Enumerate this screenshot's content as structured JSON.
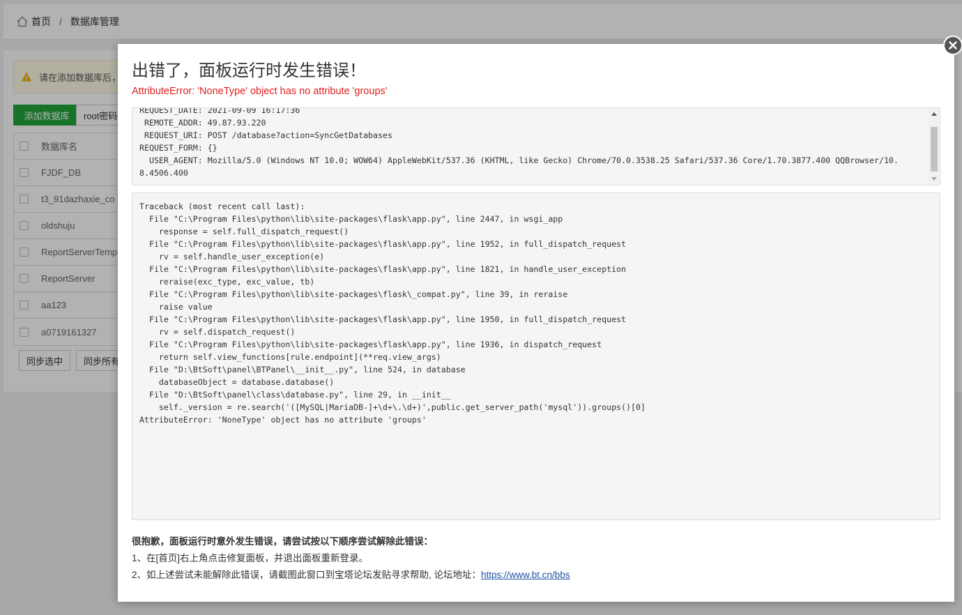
{
  "breadcrumb": {
    "home": "首页",
    "sep": "/",
    "current": "数据库管理"
  },
  "notice": {
    "text": "请在添加数据库后，务"
  },
  "toolbar": {
    "add_label": "添加数据库",
    "root_label": "root密码"
  },
  "table": {
    "header": "数据库名",
    "rows": [
      "FJDF_DB",
      "t3_91dazhaxie_co",
      "oldshuju",
      "ReportServerTempD",
      "ReportServer",
      "aa123",
      "a0719161327"
    ]
  },
  "bottom_buttons": {
    "sync_selected": "同步选中",
    "sync_all": "同步所有"
  },
  "modal": {
    "title": "出错了，面板运行时发生错误！",
    "error": "AttributeError: 'NoneType' object has no attribute 'groups'",
    "request_info": "REQUEST_DATE: 2021-09-09 16:17:36\n REMOTE_ADDR: 49.87.93.220\n REQUEST_URI: POST /database?action=SyncGetDatabases\nREQUEST_FORM: {}\n  USER_AGENT: Mozilla/5.0 (Windows NT 10.0; WOW64) AppleWebKit/537.36 (KHTML, like Gecko) Chrome/70.0.3538.25 Safari/537.36 Core/1.70.3877.400 QQBrowser/10.\n8.4506.400",
    "traceback": "Traceback (most recent call last):\n  File \"C:\\Program Files\\python\\lib\\site-packages\\flask\\app.py\", line 2447, in wsgi_app\n    response = self.full_dispatch_request()\n  File \"C:\\Program Files\\python\\lib\\site-packages\\flask\\app.py\", line 1952, in full_dispatch_request\n    rv = self.handle_user_exception(e)\n  File \"C:\\Program Files\\python\\lib\\site-packages\\flask\\app.py\", line 1821, in handle_user_exception\n    reraise(exc_type, exc_value, tb)\n  File \"C:\\Program Files\\python\\lib\\site-packages\\flask\\_compat.py\", line 39, in reraise\n    raise value\n  File \"C:\\Program Files\\python\\lib\\site-packages\\flask\\app.py\", line 1950, in full_dispatch_request\n    rv = self.dispatch_request()\n  File \"C:\\Program Files\\python\\lib\\site-packages\\flask\\app.py\", line 1936, in dispatch_request\n    return self.view_functions[rule.endpoint](**req.view_args)\n  File \"D:\\BtSoft\\panel\\BTPanel\\__init__.py\", line 524, in database\n    databaseObject = database.database()\n  File \"D:\\BtSoft\\panel\\class\\database.py\", line 29, in __init__\n    self._version = re.search('([MySQL|MariaDB-]+\\d+\\.\\d+)',public.get_server_path('mysql')).groups()[0]\nAttributeError: 'NoneType' object has no attribute 'groups'",
    "help_title": "很抱歉，面板运行时意外发生错误，请尝试按以下顺序尝试解除此错误：",
    "help_step1": "1、在[首页]右上角点击修复面板，并退出面板重新登录。",
    "help_step2": "2、如上述尝试未能解除此错误，请截图此窗口到宝塔论坛发贴寻求帮助, 论坛地址：",
    "help_link": "https://www.bt.cn/bbs"
  },
  "colors": {
    "accent_green": "#20a53a",
    "error_red": "#e02020",
    "link_blue": "#1e50a2"
  },
  "icons": [
    "home-icon",
    "warning-icon",
    "close-icon"
  ]
}
